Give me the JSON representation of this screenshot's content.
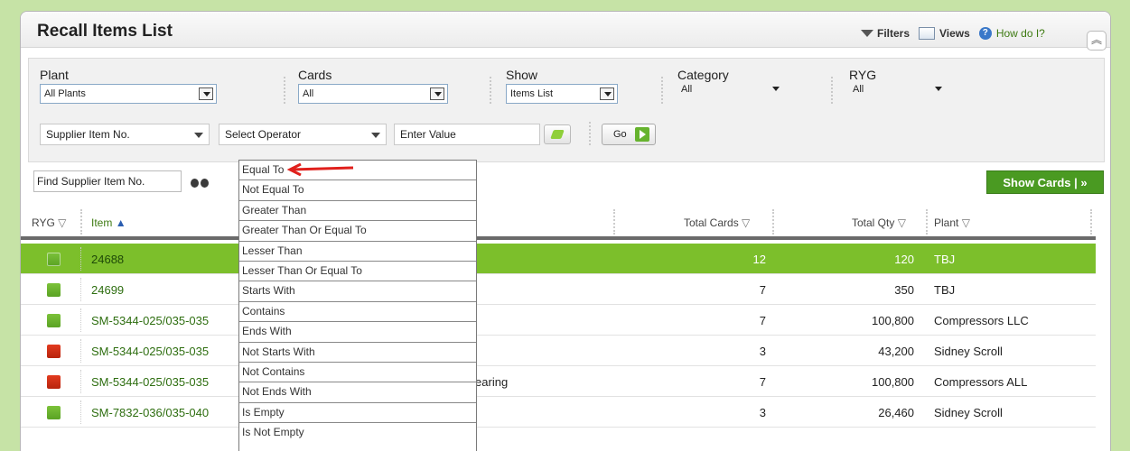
{
  "header": {
    "title": "Recall Items List",
    "filters_label": "Filters",
    "views_label": "Views",
    "help_label": "How do I?"
  },
  "filters": {
    "plant": {
      "label": "Plant",
      "value": "All Plants"
    },
    "cards": {
      "label": "Cards",
      "value": "All"
    },
    "show": {
      "label": "Show",
      "value": "Items List"
    },
    "category": {
      "label": "Category",
      "value": "All"
    },
    "ryg": {
      "label": "RYG",
      "value": "All"
    },
    "criteria": {
      "field": "Supplier Item No.",
      "operator": "Select Operator",
      "value_placeholder": "Enter Value",
      "go_label": "Go"
    }
  },
  "operator_menu": [
    "Equal To",
    "Not Equal To",
    "Greater Than",
    "Greater Than Or Equal To",
    "Lesser Than",
    "Lesser Than Or Equal To",
    "Starts With",
    "Contains",
    "Ends With",
    "Not Starts With",
    "Not Contains",
    "Not Ends With",
    "Is Empty",
    "Is Not Empty"
  ],
  "search": {
    "value": "Find Supplier Item No."
  },
  "show_cards_label": "Show Cards | »",
  "table": {
    "headers": {
      "ryg": "RYG",
      "item": "Item",
      "total_cards": "Total Cards",
      "total_qty": "Total Qty",
      "plant": "Plant"
    },
    "rows": [
      {
        "status": "green",
        "item": "24688",
        "desc": "",
        "total_cards": "12",
        "total_qty": "120",
        "plant": "TBJ",
        "selected": true
      },
      {
        "status": "green",
        "item": "24699",
        "desc": "",
        "total_cards": "7",
        "total_qty": "350",
        "plant": "TBJ",
        "selected": false
      },
      {
        "status": "green",
        "item": "SM-5344-025/035-035",
        "desc": "",
        "total_cards": "7",
        "total_qty": "100,800",
        "plant": "Compressors LLC",
        "selected": false
      },
      {
        "status": "red",
        "item": "SM-5344-025/035-035",
        "desc": "",
        "total_cards": "3",
        "total_qty": "43,200",
        "plant": "Sidney Scroll",
        "selected": false
      },
      {
        "status": "red",
        "item": "SM-5344-025/035-035",
        "desc": "DU Bearing",
        "total_cards": "7",
        "total_qty": "100,800",
        "plant": "Compressors ALL",
        "selected": false
      },
      {
        "status": "green",
        "item": "SM-7832-036/035-040",
        "desc": "",
        "total_cards": "3",
        "total_qty": "26,460",
        "plant": "Sidney Scroll",
        "selected": false
      }
    ]
  },
  "colors": {
    "green": "#7cc23a",
    "red": "#e23b1f",
    "accent": "#4a9a22"
  }
}
